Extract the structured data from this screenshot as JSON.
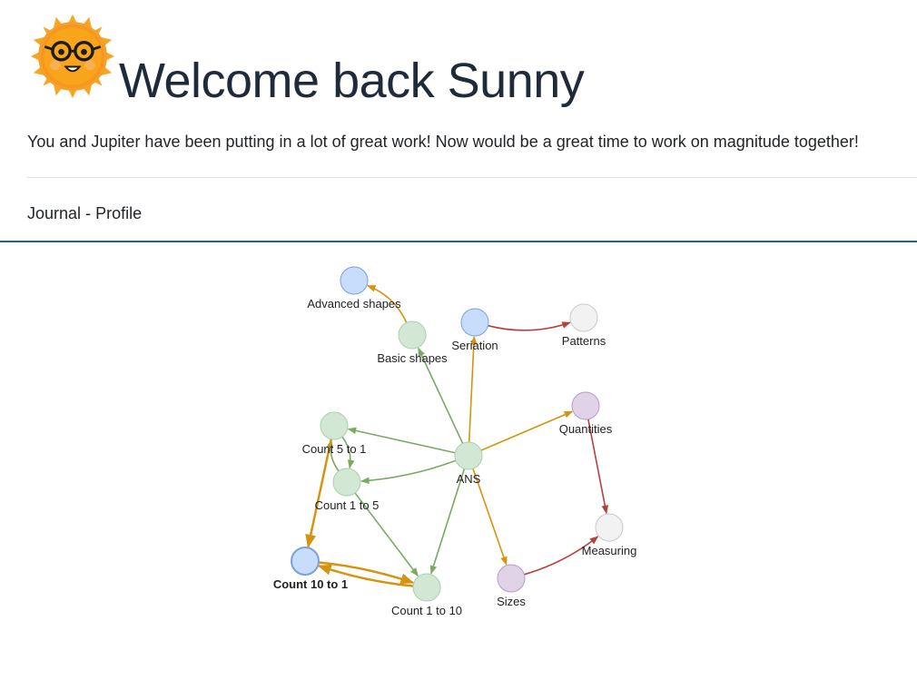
{
  "header": {
    "title": "Welcome back Sunny",
    "avatar_icon": "sun-with-glasses-icon",
    "message": "You and Jupiter have been putting in a lot of great work! Now would be a great time to work on magnitude together!"
  },
  "nav": {
    "journal_label": "Journal",
    "separator": "-",
    "profile_label": "Profile"
  },
  "colors": {
    "green_node_fill": "#d3e8d4",
    "green_node_stroke": "#a9cfab",
    "blue_node_fill": "#c8dcfb",
    "blue_node_stroke": "#7aa0de",
    "purple_node_fill": "#e0d3e8",
    "purple_node_stroke": "#b69ac9",
    "gray_node_fill": "#f2f2f2",
    "gray_node_stroke": "#c9c9c9",
    "green_edge": "#7aaa62",
    "orange_edge": "#d4940f",
    "red_edge": "#b3413f",
    "divider_blue": "#1f5ea8"
  },
  "graph": {
    "nodes": [
      {
        "id": "advanced-shapes",
        "label": "Advanced shapes",
        "color": "blue",
        "bold": false
      },
      {
        "id": "basic-shapes",
        "label": "Basic shapes",
        "color": "green",
        "bold": false
      },
      {
        "id": "seriation",
        "label": "Seriation",
        "color": "blue",
        "bold": false
      },
      {
        "id": "patterns",
        "label": "Patterns",
        "color": "gray",
        "bold": false
      },
      {
        "id": "quantities",
        "label": "Quantities",
        "color": "purple",
        "bold": false
      },
      {
        "id": "count-5-to-1",
        "label": "Count 5 to 1",
        "color": "green",
        "bold": false
      },
      {
        "id": "ans",
        "label": "ANS",
        "color": "green",
        "bold": false
      },
      {
        "id": "count-1-to-5",
        "label": "Count 1 to 5",
        "color": "green",
        "bold": false
      },
      {
        "id": "measuring",
        "label": "Measuring",
        "color": "gray",
        "bold": false
      },
      {
        "id": "count-10-to-1",
        "label": "Count 10 to 1",
        "color": "blue",
        "bold": true
      },
      {
        "id": "sizes",
        "label": "Sizes",
        "color": "purple",
        "bold": false
      },
      {
        "id": "count-1-to-10",
        "label": "Count 1 to 10",
        "color": "green",
        "bold": false
      }
    ],
    "edges": [
      {
        "from": "basic-shapes",
        "to": "advanced-shapes",
        "color": "orange"
      },
      {
        "from": "ans",
        "to": "basic-shapes",
        "color": "green"
      },
      {
        "from": "ans",
        "to": "seriation",
        "color": "orange"
      },
      {
        "from": "seriation",
        "to": "patterns",
        "color": "red"
      },
      {
        "from": "ans",
        "to": "quantities",
        "color": "orange"
      },
      {
        "from": "quantities",
        "to": "measuring",
        "color": "red"
      },
      {
        "from": "ans",
        "to": "count-5-to-1",
        "color": "green"
      },
      {
        "from": "ans",
        "to": "count-1-to-5",
        "color": "green"
      },
      {
        "from": "ans",
        "to": "count-1-to-10",
        "color": "green"
      },
      {
        "from": "ans",
        "to": "sizes",
        "color": "orange"
      },
      {
        "from": "sizes",
        "to": "measuring",
        "color": "red"
      },
      {
        "from": "count-5-to-1",
        "to": "count-1-to-5",
        "color": "green"
      },
      {
        "from": "count-1-to-5",
        "to": "count-5-to-1",
        "color": "green"
      },
      {
        "from": "count-5-to-1",
        "to": "count-10-to-1",
        "color": "orange"
      },
      {
        "from": "count-1-to-5",
        "to": "count-1-to-10",
        "color": "green"
      },
      {
        "from": "count-10-to-1",
        "to": "count-1-to-10",
        "color": "orange"
      },
      {
        "from": "count-1-to-10",
        "to": "count-10-to-1",
        "color": "orange"
      }
    ]
  }
}
